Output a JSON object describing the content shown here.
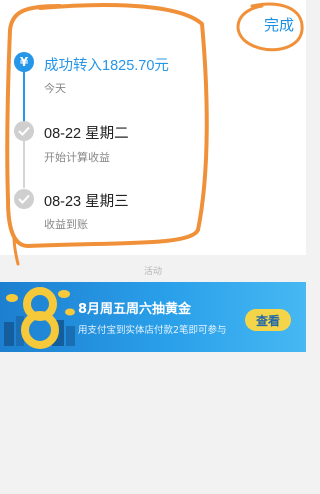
{
  "header": {
    "done_label": "完成"
  },
  "timeline": {
    "steps": [
      {
        "title": "成功转入1825.70元",
        "subtitle": "今天",
        "state": "active",
        "icon": "yen-icon"
      },
      {
        "title": "08-22 星期二",
        "subtitle": "开始计算收益",
        "state": "pending",
        "icon": "check-icon"
      },
      {
        "title": "08-23 星期三",
        "subtitle": "收益到账",
        "state": "pending",
        "icon": "check-icon"
      }
    ]
  },
  "section": {
    "label": "活动"
  },
  "banner": {
    "title": "8月周五周六抽黄金",
    "subtitle": "用支付宝到实体店付款2笔即可参与",
    "button_label": "查看",
    "art_digit": "8"
  },
  "colors": {
    "accent": "#2596e8",
    "annotation": "#f0913a",
    "banner_button": "#f4d54a"
  }
}
